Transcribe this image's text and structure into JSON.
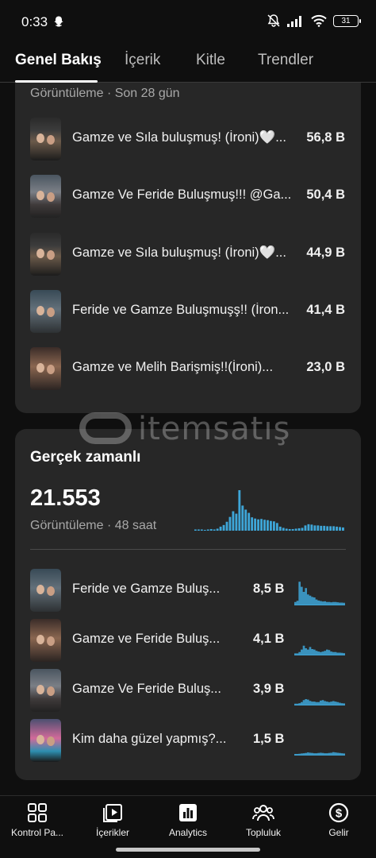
{
  "status_bar": {
    "time": "0:33",
    "battery": "31"
  },
  "tabs": [
    {
      "label": "Genel Bakış",
      "active": true
    },
    {
      "label": "İçerik",
      "active": false
    },
    {
      "label": "Kitle",
      "active": false
    },
    {
      "label": "Trendler",
      "active": false
    }
  ],
  "top_content": {
    "subtitle": "Görüntüleme · Son 28 gün",
    "items": [
      {
        "title": "Gamze ve Sıla buluşmuş! (İroni)🤍...",
        "value": "56,8 B"
      },
      {
        "title": "Gamze Ve Feride Buluşmuş!!! @Ga...",
        "value": "50,4 B"
      },
      {
        "title": "Gamze ve Sıla buluşmuş! (İroni)🤍...",
        "value": "44,9 B"
      },
      {
        "title": "Feride ve Gamze Buluşmuşş!! (İron...",
        "value": "41,4 B"
      },
      {
        "title": "Gamze ve Melih Barişmiş!!(İroni)...",
        "value": "23,0 B"
      }
    ]
  },
  "realtime": {
    "title": "Gerçek zamanlı",
    "total": "21.553",
    "subtitle": "Görüntüleme · 48 saat",
    "bar_color": "#3ea6d8",
    "hourly_views": [
      0.03,
      0.03,
      0.03,
      0.02,
      0.03,
      0.04,
      0.03,
      0.05,
      0.1,
      0.14,
      0.22,
      0.34,
      0.48,
      0.42,
      1.0,
      0.62,
      0.52,
      0.44,
      0.33,
      0.3,
      0.28,
      0.29,
      0.27,
      0.26,
      0.24,
      0.23,
      0.19,
      0.1,
      0.07,
      0.05,
      0.04,
      0.04,
      0.05,
      0.06,
      0.07,
      0.13,
      0.16,
      0.15,
      0.13,
      0.13,
      0.12,
      0.12,
      0.11,
      0.11,
      0.11,
      0.1,
      0.09,
      0.08
    ],
    "items": [
      {
        "title": "Feride ve Gamze Buluş...",
        "value": "8,5 B",
        "trend": [
          0.1,
          0.15,
          0.9,
          0.7,
          0.5,
          0.65,
          0.4,
          0.35,
          0.3,
          0.28,
          0.2,
          0.16,
          0.14,
          0.12,
          0.13,
          0.1,
          0.1,
          0.09,
          0.1,
          0.1,
          0.09,
          0.08,
          0.08,
          0.07
        ]
      },
      {
        "title": "Gamze ve Feride Buluş...",
        "value": "4,1 B",
        "trend": [
          0.05,
          0.05,
          0.1,
          0.2,
          0.35,
          0.25,
          0.2,
          0.3,
          0.22,
          0.2,
          0.15,
          0.12,
          0.1,
          0.12,
          0.15,
          0.2,
          0.18,
          0.12,
          0.1,
          0.1,
          0.08,
          0.08,
          0.07,
          0.06
        ]
      },
      {
        "title": "Gamze Ve Feride Buluş...",
        "value": "3,9 B",
        "trend": [
          0.04,
          0.04,
          0.06,
          0.1,
          0.18,
          0.22,
          0.2,
          0.15,
          0.12,
          0.12,
          0.1,
          0.1,
          0.16,
          0.18,
          0.14,
          0.12,
          0.1,
          0.12,
          0.14,
          0.12,
          0.1,
          0.08,
          0.06,
          0.05
        ]
      },
      {
        "title": "Kim daha güzel yapmış?...",
        "value": "1,5 B",
        "trend": [
          0.03,
          0.03,
          0.04,
          0.05,
          0.06,
          0.07,
          0.09,
          0.08,
          0.07,
          0.06,
          0.06,
          0.07,
          0.08,
          0.07,
          0.06,
          0.06,
          0.07,
          0.08,
          0.1,
          0.09,
          0.08,
          0.07,
          0.06,
          0.05
        ]
      }
    ]
  },
  "watermark": {
    "text": "itemsatış"
  },
  "bottom_nav": [
    {
      "label": "Kontrol Pa...",
      "icon": "dashboard-icon"
    },
    {
      "label": "İçerikler",
      "icon": "content-icon"
    },
    {
      "label": "Analytics",
      "icon": "analytics-icon"
    },
    {
      "label": "Topluluk",
      "icon": "community-icon"
    },
    {
      "label": "Gelir",
      "icon": "earn-icon"
    }
  ]
}
